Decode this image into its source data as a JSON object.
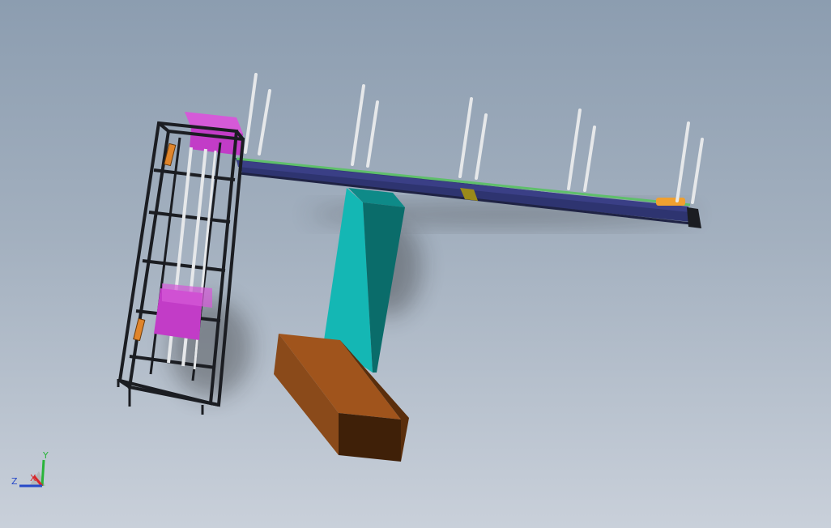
{
  "viewport": {
    "background_top": "#8c9db0",
    "background_bottom": "#c9d0da"
  },
  "model": {
    "frame_color": "#1b1d22",
    "motor_color": "#c23cc7",
    "conveyor_belt_color": "#3a3f86",
    "conveyor_rail_color": "#5fbf6b",
    "pillar_color": "#14b7b4",
    "base_color": "#8a4a1a",
    "pole_color": "#e6e8ea",
    "stopper_color": "#f0a030"
  },
  "triad": {
    "x_label": "X",
    "y_label": "Y",
    "z_label": "Z",
    "x_color": "#d8262a",
    "y_color": "#29b43a",
    "z_color": "#2749c8"
  }
}
